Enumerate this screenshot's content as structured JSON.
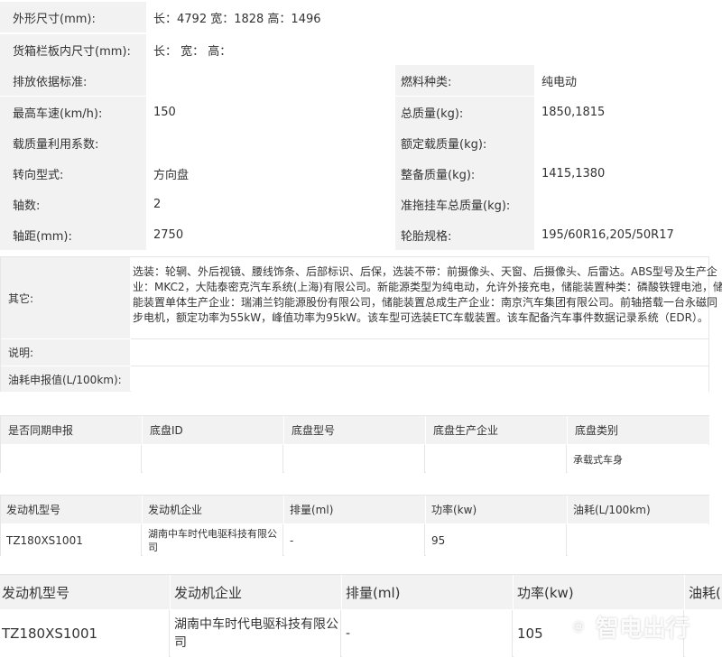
{
  "spec": {
    "dimensions": {
      "label": "外形尺寸(mm):",
      "value": "长：4792 宽：1828 高：1496"
    },
    "cargo": {
      "label": "货箱栏板内尺寸(mm):",
      "value": "长：  宽：  高："
    },
    "emission": {
      "label": "排放依据标准:",
      "value": ""
    },
    "fuel": {
      "label": "燃料种类:",
      "value": "纯电动"
    },
    "top_speed": {
      "label": "最高车速(km/h):",
      "value": "150"
    },
    "gross_mass": {
      "label": "总质量(kg):",
      "value": "1850,1815"
    },
    "load_factor": {
      "label": "载质量利用系数:",
      "value": ""
    },
    "rated_load": {
      "label": "额定载质量(kg):",
      "value": ""
    },
    "steering": {
      "label": "转向型式:",
      "value": "方向盘"
    },
    "curb_mass": {
      "label": "整备质量(kg):",
      "value": "1415,1380"
    },
    "axles": {
      "label": "轴数:",
      "value": "2"
    },
    "tow_mass": {
      "label": "准拖挂车总质量(kg):",
      "value": ""
    },
    "wheelbase": {
      "label": "轴距(mm):",
      "value": "2750"
    },
    "tires": {
      "label": "轮胎规格:",
      "value": "195/60R16,205/50R17"
    }
  },
  "other": {
    "label": "其它:",
    "lines": [
      "选装：轮辋、外后视镜、腰线饰条、后部标识、后保，选装不带：前摄像头、天窗、后摄像头、后雷达。ABS型号及生产企",
      "业：MKC2，大陆泰密克汽车系统(上海)有限公司。新能源类型为纯电动，允许外接充电，储能装置种类：磷酸铁锂电池，储",
      "能装置单体生产企业：瑞浦兰钧能源股份有限公司，储能装置总成生产企业：南京汽车集团有限公司。前轴搭载一台永磁同",
      "步电机，额定功率为55kW，峰值功率为95kW。该车型可选装ETC车载装置。该车配备汽车事件数据记录系统（EDR）。"
    ]
  },
  "note": {
    "label": "说明:",
    "value": ""
  },
  "fuel_report": {
    "label": "油耗申报值(L/100km):",
    "value": ""
  },
  "chassis": {
    "headers": [
      "是否同期申报",
      "底盘ID",
      "底盘型号",
      "底盘生产企业",
      "底盘类别"
    ],
    "row": [
      "",
      "",
      "",
      "",
      "承载式车身"
    ]
  },
  "motor1": {
    "headers": [
      "发动机型号",
      "发动机企业",
      "排量(ml)",
      "功率(kw)",
      "油耗(L/100km)"
    ],
    "row": [
      "TZ180XS1001",
      "湖南中车时代电驱科技有限公司",
      "-",
      "95",
      ""
    ]
  },
  "motor2": {
    "headers": [
      "发动机型号",
      "发动机企业",
      "排量(ml)",
      "功率(kw)",
      "油耗(L"
    ],
    "row": [
      "TZ180XS1001",
      "湖南中车时代电驱科技有限公司",
      "-",
      "105",
      ""
    ]
  },
  "watermark": {
    "symbol": "@",
    "text": "智电出行"
  }
}
